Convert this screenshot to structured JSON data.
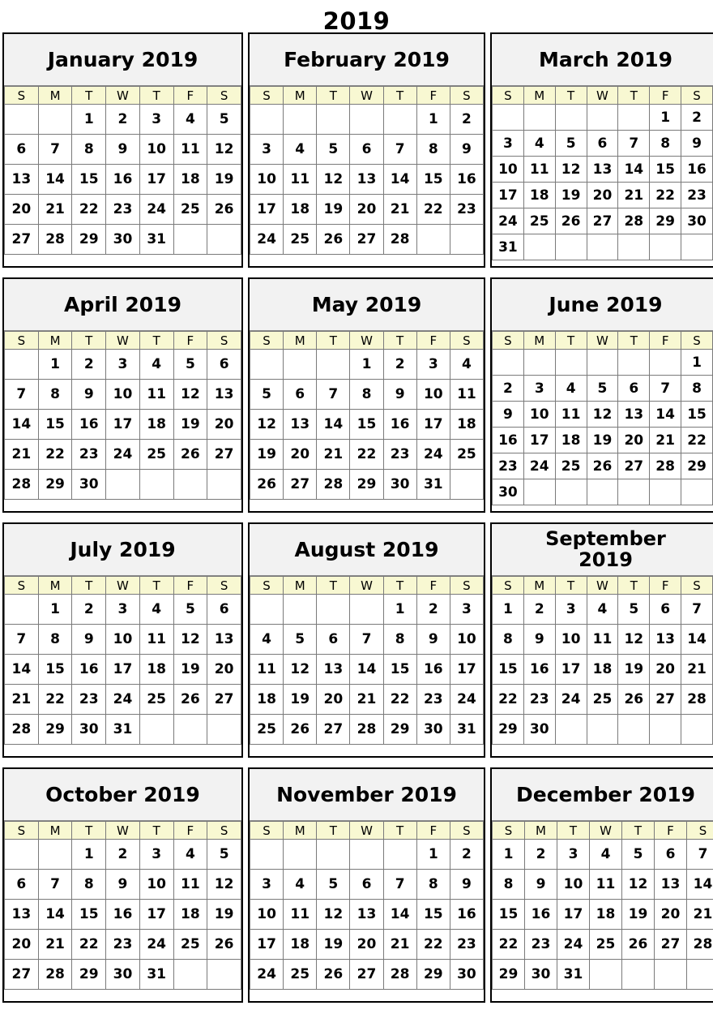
{
  "page": {
    "year_title": "2019"
  },
  "weekday_headers": [
    "S",
    "M",
    "T",
    "W",
    "T",
    "F",
    "S"
  ],
  "months": [
    {
      "name": "January",
      "title": "January 2019",
      "weeks": [
        [
          "",
          "",
          "1",
          "2",
          "3",
          "4",
          "5"
        ],
        [
          "6",
          "7",
          "8",
          "9",
          "10",
          "11",
          "12"
        ],
        [
          "13",
          "14",
          "15",
          "16",
          "17",
          "18",
          "19"
        ],
        [
          "20",
          "21",
          "22",
          "23",
          "24",
          "25",
          "26"
        ],
        [
          "27",
          "28",
          "29",
          "30",
          "31",
          "",
          ""
        ]
      ]
    },
    {
      "name": "February",
      "title": "February 2019",
      "weeks": [
        [
          "",
          "",
          "",
          "",
          "",
          "1",
          "2"
        ],
        [
          "3",
          "4",
          "5",
          "6",
          "7",
          "8",
          "9"
        ],
        [
          "10",
          "11",
          "12",
          "13",
          "14",
          "15",
          "16"
        ],
        [
          "17",
          "18",
          "19",
          "20",
          "21",
          "22",
          "23"
        ],
        [
          "24",
          "25",
          "26",
          "27",
          "28",
          "",
          ""
        ]
      ]
    },
    {
      "name": "March",
      "title": "March 2019",
      "weeks": [
        [
          "",
          "",
          "",
          "",
          "",
          "1",
          "2"
        ],
        [
          "3",
          "4",
          "5",
          "6",
          "7",
          "8",
          "9"
        ],
        [
          "10",
          "11",
          "12",
          "13",
          "14",
          "15",
          "16"
        ],
        [
          "17",
          "18",
          "19",
          "20",
          "21",
          "22",
          "23"
        ],
        [
          "24",
          "25",
          "26",
          "27",
          "28",
          "29",
          "30"
        ],
        [
          "31",
          "",
          "",
          "",
          "",
          "",
          ""
        ]
      ]
    },
    {
      "name": "April",
      "title": "April 2019",
      "weeks": [
        [
          "",
          "1",
          "2",
          "3",
          "4",
          "5",
          "6"
        ],
        [
          "7",
          "8",
          "9",
          "10",
          "11",
          "12",
          "13"
        ],
        [
          "14",
          "15",
          "16",
          "17",
          "18",
          "19",
          "20"
        ],
        [
          "21",
          "22",
          "23",
          "24",
          "25",
          "26",
          "27"
        ],
        [
          "28",
          "29",
          "30",
          "",
          "",
          "",
          ""
        ]
      ]
    },
    {
      "name": "May",
      "title": "May 2019",
      "weeks": [
        [
          "",
          "",
          "",
          "1",
          "2",
          "3",
          "4"
        ],
        [
          "5",
          "6",
          "7",
          "8",
          "9",
          "10",
          "11"
        ],
        [
          "12",
          "13",
          "14",
          "15",
          "16",
          "17",
          "18"
        ],
        [
          "19",
          "20",
          "21",
          "22",
          "23",
          "24",
          "25"
        ],
        [
          "26",
          "27",
          "28",
          "29",
          "30",
          "31",
          ""
        ]
      ]
    },
    {
      "name": "June",
      "title": "June 2019",
      "weeks": [
        [
          "",
          "",
          "",
          "",
          "",
          "",
          "1"
        ],
        [
          "2",
          "3",
          "4",
          "5",
          "6",
          "7",
          "8"
        ],
        [
          "9",
          "10",
          "11",
          "12",
          "13",
          "14",
          "15"
        ],
        [
          "16",
          "17",
          "18",
          "19",
          "20",
          "21",
          "22"
        ],
        [
          "23",
          "24",
          "25",
          "26",
          "27",
          "28",
          "29"
        ],
        [
          "30",
          "",
          "",
          "",
          "",
          "",
          ""
        ]
      ]
    },
    {
      "name": "July",
      "title": "July 2019",
      "weeks": [
        [
          "",
          "1",
          "2",
          "3",
          "4",
          "5",
          "6"
        ],
        [
          "7",
          "8",
          "9",
          "10",
          "11",
          "12",
          "13"
        ],
        [
          "14",
          "15",
          "16",
          "17",
          "18",
          "19",
          "20"
        ],
        [
          "21",
          "22",
          "23",
          "24",
          "25",
          "26",
          "27"
        ],
        [
          "28",
          "29",
          "30",
          "31",
          "",
          "",
          ""
        ]
      ]
    },
    {
      "name": "August",
      "title": "August 2019",
      "weeks": [
        [
          "",
          "",
          "",
          "",
          "1",
          "2",
          "3"
        ],
        [
          "4",
          "5",
          "6",
          "7",
          "8",
          "9",
          "10"
        ],
        [
          "11",
          "12",
          "13",
          "14",
          "15",
          "16",
          "17"
        ],
        [
          "18",
          "19",
          "20",
          "21",
          "22",
          "23",
          "24"
        ],
        [
          "25",
          "26",
          "27",
          "28",
          "29",
          "30",
          "31"
        ]
      ]
    },
    {
      "name": "September",
      "title": "September 2019",
      "title_lines": [
        "September",
        "2019"
      ],
      "weeks": [
        [
          "1",
          "2",
          "3",
          "4",
          "5",
          "6",
          "7"
        ],
        [
          "8",
          "9",
          "10",
          "11",
          "12",
          "13",
          "14"
        ],
        [
          "15",
          "16",
          "17",
          "18",
          "19",
          "20",
          "21"
        ],
        [
          "22",
          "23",
          "24",
          "25",
          "26",
          "27",
          "28"
        ],
        [
          "29",
          "30",
          "",
          "",
          "",
          "",
          ""
        ]
      ]
    },
    {
      "name": "October",
      "title": "October 2019",
      "weeks": [
        [
          "",
          "",
          "1",
          "2",
          "3",
          "4",
          "5"
        ],
        [
          "6",
          "7",
          "8",
          "9",
          "10",
          "11",
          "12"
        ],
        [
          "13",
          "14",
          "15",
          "16",
          "17",
          "18",
          "19"
        ],
        [
          "20",
          "21",
          "22",
          "23",
          "24",
          "25",
          "26"
        ],
        [
          "27",
          "28",
          "29",
          "30",
          "31",
          "",
          ""
        ]
      ]
    },
    {
      "name": "November",
      "title": "November 2019",
      "weeks": [
        [
          "",
          "",
          "",
          "",
          "",
          "1",
          "2"
        ],
        [
          "3",
          "4",
          "5",
          "6",
          "7",
          "8",
          "9"
        ],
        [
          "10",
          "11",
          "12",
          "13",
          "14",
          "15",
          "16"
        ],
        [
          "17",
          "18",
          "19",
          "20",
          "21",
          "22",
          "23"
        ],
        [
          "24",
          "25",
          "26",
          "27",
          "28",
          "29",
          "30"
        ]
      ]
    },
    {
      "name": "December",
      "title": "December 2019",
      "weeks": [
        [
          "1",
          "2",
          "3",
          "4",
          "5",
          "6",
          "7"
        ],
        [
          "8",
          "9",
          "10",
          "11",
          "12",
          "13",
          "14"
        ],
        [
          "15",
          "16",
          "17",
          "18",
          "19",
          "20",
          "21"
        ],
        [
          "22",
          "23",
          "24",
          "25",
          "26",
          "27",
          "28"
        ],
        [
          "29",
          "30",
          "31",
          "",
          "",
          "",
          ""
        ]
      ]
    }
  ],
  "colors": {
    "panel_border": "#000000",
    "title_background": "#f2f2f2",
    "weekday_background": "#f8f8d2",
    "cell_border": "#7a7a7a",
    "text": "#000000",
    "page_background": "#ffffff"
  }
}
